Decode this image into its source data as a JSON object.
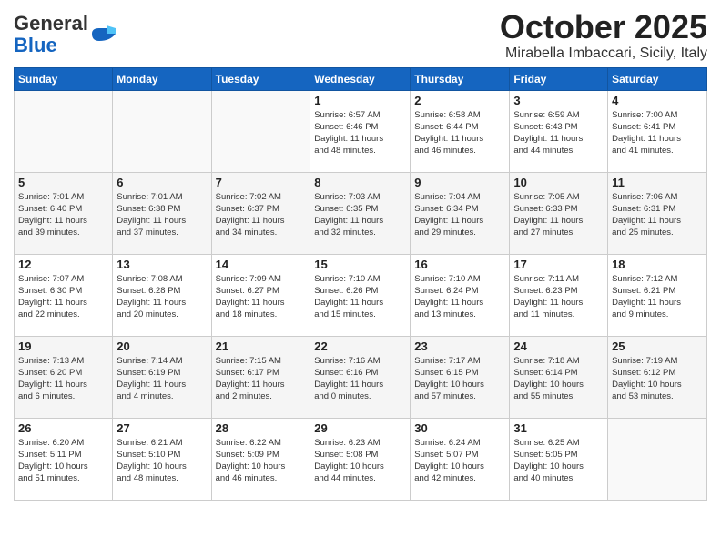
{
  "header": {
    "logo_general": "General",
    "logo_blue": "Blue",
    "month_title": "October 2025",
    "location": "Mirabella Imbaccari, Sicily, Italy"
  },
  "days_of_week": [
    "Sunday",
    "Monday",
    "Tuesday",
    "Wednesday",
    "Thursday",
    "Friday",
    "Saturday"
  ],
  "weeks": [
    {
      "days": [
        {
          "num": "",
          "info": ""
        },
        {
          "num": "",
          "info": ""
        },
        {
          "num": "",
          "info": ""
        },
        {
          "num": "1",
          "info": "Sunrise: 6:57 AM\nSunset: 6:46 PM\nDaylight: 11 hours\nand 48 minutes."
        },
        {
          "num": "2",
          "info": "Sunrise: 6:58 AM\nSunset: 6:44 PM\nDaylight: 11 hours\nand 46 minutes."
        },
        {
          "num": "3",
          "info": "Sunrise: 6:59 AM\nSunset: 6:43 PM\nDaylight: 11 hours\nand 44 minutes."
        },
        {
          "num": "4",
          "info": "Sunrise: 7:00 AM\nSunset: 6:41 PM\nDaylight: 11 hours\nand 41 minutes."
        }
      ]
    },
    {
      "days": [
        {
          "num": "5",
          "info": "Sunrise: 7:01 AM\nSunset: 6:40 PM\nDaylight: 11 hours\nand 39 minutes."
        },
        {
          "num": "6",
          "info": "Sunrise: 7:01 AM\nSunset: 6:38 PM\nDaylight: 11 hours\nand 37 minutes."
        },
        {
          "num": "7",
          "info": "Sunrise: 7:02 AM\nSunset: 6:37 PM\nDaylight: 11 hours\nand 34 minutes."
        },
        {
          "num": "8",
          "info": "Sunrise: 7:03 AM\nSunset: 6:35 PM\nDaylight: 11 hours\nand 32 minutes."
        },
        {
          "num": "9",
          "info": "Sunrise: 7:04 AM\nSunset: 6:34 PM\nDaylight: 11 hours\nand 29 minutes."
        },
        {
          "num": "10",
          "info": "Sunrise: 7:05 AM\nSunset: 6:33 PM\nDaylight: 11 hours\nand 27 minutes."
        },
        {
          "num": "11",
          "info": "Sunrise: 7:06 AM\nSunset: 6:31 PM\nDaylight: 11 hours\nand 25 minutes."
        }
      ]
    },
    {
      "days": [
        {
          "num": "12",
          "info": "Sunrise: 7:07 AM\nSunset: 6:30 PM\nDaylight: 11 hours\nand 22 minutes."
        },
        {
          "num": "13",
          "info": "Sunrise: 7:08 AM\nSunset: 6:28 PM\nDaylight: 11 hours\nand 20 minutes."
        },
        {
          "num": "14",
          "info": "Sunrise: 7:09 AM\nSunset: 6:27 PM\nDaylight: 11 hours\nand 18 minutes."
        },
        {
          "num": "15",
          "info": "Sunrise: 7:10 AM\nSunset: 6:26 PM\nDaylight: 11 hours\nand 15 minutes."
        },
        {
          "num": "16",
          "info": "Sunrise: 7:10 AM\nSunset: 6:24 PM\nDaylight: 11 hours\nand 13 minutes."
        },
        {
          "num": "17",
          "info": "Sunrise: 7:11 AM\nSunset: 6:23 PM\nDaylight: 11 hours\nand 11 minutes."
        },
        {
          "num": "18",
          "info": "Sunrise: 7:12 AM\nSunset: 6:21 PM\nDaylight: 11 hours\nand 9 minutes."
        }
      ]
    },
    {
      "days": [
        {
          "num": "19",
          "info": "Sunrise: 7:13 AM\nSunset: 6:20 PM\nDaylight: 11 hours\nand 6 minutes."
        },
        {
          "num": "20",
          "info": "Sunrise: 7:14 AM\nSunset: 6:19 PM\nDaylight: 11 hours\nand 4 minutes."
        },
        {
          "num": "21",
          "info": "Sunrise: 7:15 AM\nSunset: 6:17 PM\nDaylight: 11 hours\nand 2 minutes."
        },
        {
          "num": "22",
          "info": "Sunrise: 7:16 AM\nSunset: 6:16 PM\nDaylight: 11 hours\nand 0 minutes."
        },
        {
          "num": "23",
          "info": "Sunrise: 7:17 AM\nSunset: 6:15 PM\nDaylight: 10 hours\nand 57 minutes."
        },
        {
          "num": "24",
          "info": "Sunrise: 7:18 AM\nSunset: 6:14 PM\nDaylight: 10 hours\nand 55 minutes."
        },
        {
          "num": "25",
          "info": "Sunrise: 7:19 AM\nSunset: 6:12 PM\nDaylight: 10 hours\nand 53 minutes."
        }
      ]
    },
    {
      "days": [
        {
          "num": "26",
          "info": "Sunrise: 6:20 AM\nSunset: 5:11 PM\nDaylight: 10 hours\nand 51 minutes."
        },
        {
          "num": "27",
          "info": "Sunrise: 6:21 AM\nSunset: 5:10 PM\nDaylight: 10 hours\nand 48 minutes."
        },
        {
          "num": "28",
          "info": "Sunrise: 6:22 AM\nSunset: 5:09 PM\nDaylight: 10 hours\nand 46 minutes."
        },
        {
          "num": "29",
          "info": "Sunrise: 6:23 AM\nSunset: 5:08 PM\nDaylight: 10 hours\nand 44 minutes."
        },
        {
          "num": "30",
          "info": "Sunrise: 6:24 AM\nSunset: 5:07 PM\nDaylight: 10 hours\nand 42 minutes."
        },
        {
          "num": "31",
          "info": "Sunrise: 6:25 AM\nSunset: 5:05 PM\nDaylight: 10 hours\nand 40 minutes."
        },
        {
          "num": "",
          "info": ""
        }
      ]
    }
  ]
}
